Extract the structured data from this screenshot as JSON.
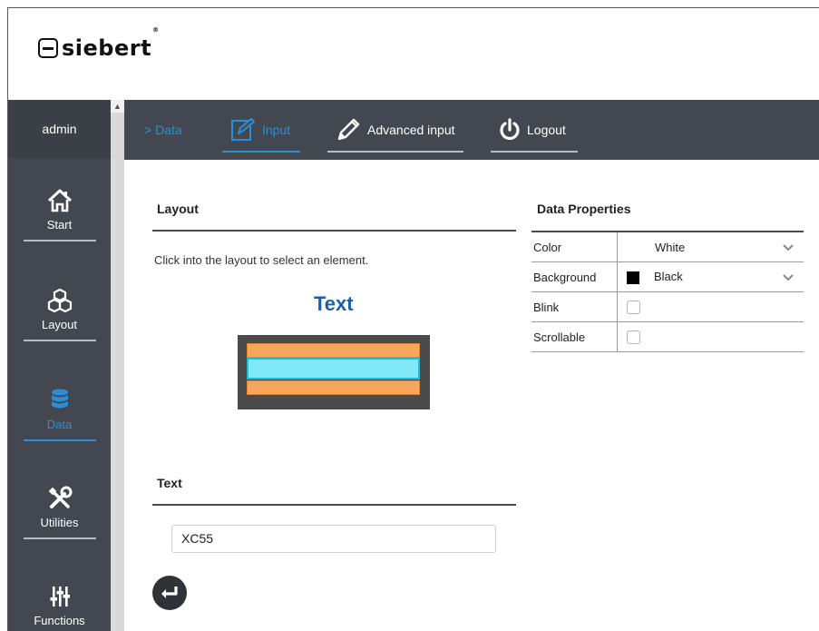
{
  "brand": {
    "name": "siebert",
    "registered": "®"
  },
  "sidebar": {
    "user": "admin",
    "items": [
      {
        "label": "Start",
        "icon": "home-icon"
      },
      {
        "label": "Layout",
        "icon": "cubes-icon"
      },
      {
        "label": "Data",
        "icon": "database-icon",
        "active": true
      },
      {
        "label": "Utilities",
        "icon": "tools-icon"
      },
      {
        "label": "Functions",
        "icon": "sliders-icon"
      }
    ]
  },
  "topnav": {
    "breadcrumb": "> Data",
    "tabs": [
      {
        "label": "Input",
        "icon": "edit-icon",
        "active": true
      },
      {
        "label": "Advanced input",
        "icon": "pencil-icon"
      },
      {
        "label": "Logout",
        "icon": "power-icon"
      }
    ]
  },
  "layout_panel": {
    "title": "Layout",
    "hint": "Click into the layout to select an element.",
    "preview_label": "Text"
  },
  "text_panel": {
    "title": "Text",
    "value": "XC55"
  },
  "properties": {
    "title": "Data Properties",
    "rows": [
      {
        "key": "Color",
        "value": "White",
        "type": "select"
      },
      {
        "key": "Background",
        "value": "Black",
        "type": "select",
        "swatch": "#000000"
      },
      {
        "key": "Blink",
        "type": "checkbox",
        "checked": false
      },
      {
        "key": "Scrollable",
        "type": "checkbox",
        "checked": false
      }
    ]
  },
  "colors": {
    "sidebar_bg": "#434850",
    "accent": "#2a8fd8",
    "title_blue": "#1f5fa8",
    "block_orange": "#f7a75b",
    "block_selected": "#80e8f6"
  }
}
